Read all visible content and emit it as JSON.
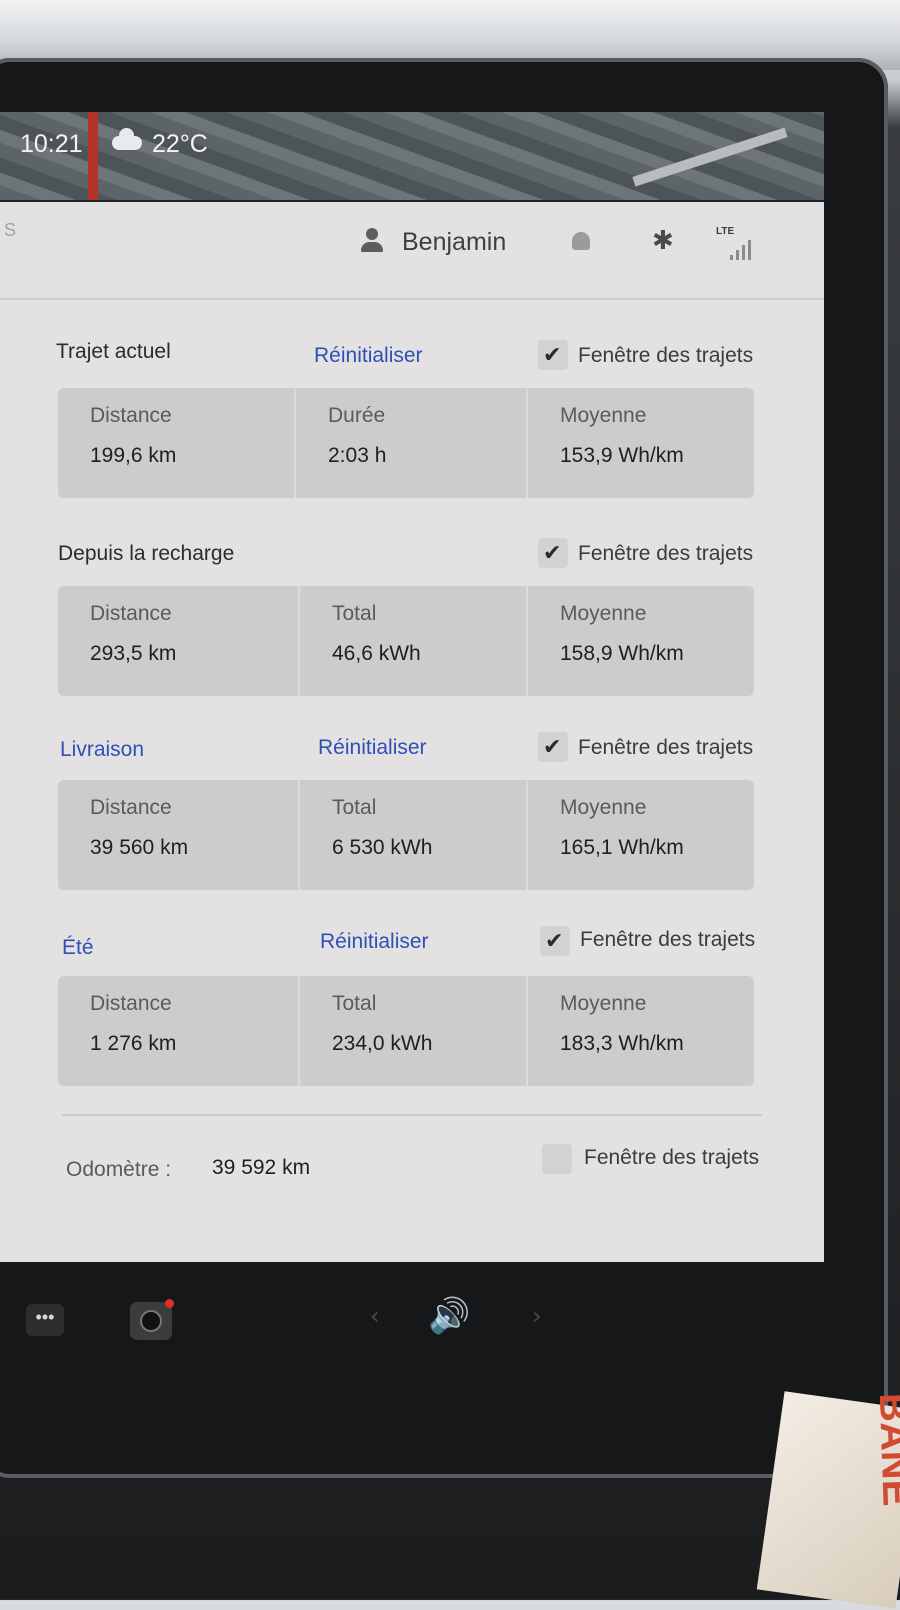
{
  "status_bar": {
    "time": "10:21",
    "temperature": "22°C"
  },
  "top_bar": {
    "user_name": "Benjamin",
    "network": "LTE",
    "side_fragment": "S"
  },
  "sections": [
    {
      "title": "Trajet actuel",
      "reset_label": "Réinitialiser",
      "checkbox_label": "Fenêtre des trajets",
      "checked": true,
      "stats": [
        {
          "label": "Distance",
          "value": "199,6 km"
        },
        {
          "label": "Durée",
          "value": "2:03 h"
        },
        {
          "label": "Moyenne",
          "value": "153,9 Wh/km"
        }
      ]
    },
    {
      "title": "Depuis la recharge",
      "checkbox_label": "Fenêtre des trajets",
      "checked": true,
      "stats": [
        {
          "label": "Distance",
          "value": "293,5 km"
        },
        {
          "label": "Total",
          "value": "46,6 kWh"
        },
        {
          "label": "Moyenne",
          "value": "158,9 Wh/km"
        }
      ]
    },
    {
      "title": "Livraison",
      "reset_label": "Réinitialiser",
      "checkbox_label": "Fenêtre des trajets",
      "checked": true,
      "stats": [
        {
          "label": "Distance",
          "value": "39 560 km"
        },
        {
          "label": "Total",
          "value": "6 530 kWh"
        },
        {
          "label": "Moyenne",
          "value": "165,1 Wh/km"
        }
      ]
    },
    {
      "title": "Été",
      "reset_label": "Réinitialiser",
      "checkbox_label": "Fenêtre des trajets",
      "checked": true,
      "stats": [
        {
          "label": "Distance",
          "value": "1 276 km"
        },
        {
          "label": "Total",
          "value": "234,0 kWh"
        },
        {
          "label": "Moyenne",
          "value": "183,3 Wh/km"
        }
      ]
    }
  ],
  "odometer": {
    "label": "Odomètre :",
    "value": "39 592 km",
    "checkbox_label": "Fenêtre des trajets",
    "checked": false
  },
  "taskbar": {
    "more_glyph": "•••",
    "volume_glyph": "🔊",
    "left_arrow": "‹",
    "right_arrow": "›"
  },
  "background": {
    "bag_text": "BANE"
  },
  "colors": {
    "accent_blue": "#2e50b8",
    "panel": "#e3e1e2",
    "stat_box": "#cdcbcc",
    "camera_dot": "#e0302b"
  }
}
